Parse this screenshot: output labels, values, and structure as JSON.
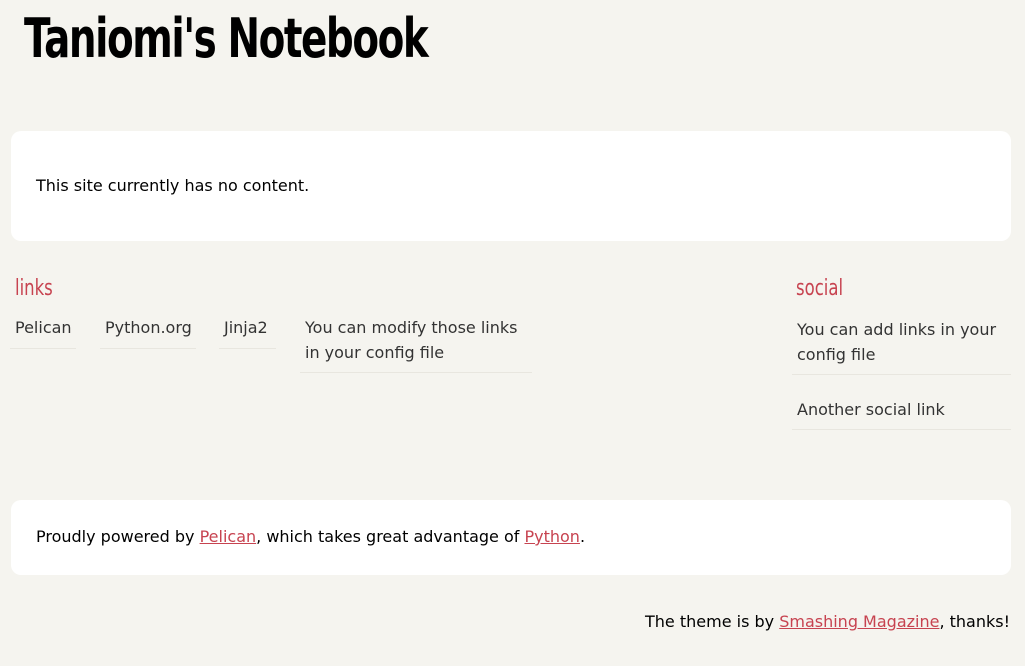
{
  "header": {
    "site_title": "Taniomi's Notebook"
  },
  "content": {
    "message": "This site currently has no content."
  },
  "blogroll": {
    "title": "links",
    "items": [
      {
        "label": "Pelican"
      },
      {
        "label": "Python.org"
      },
      {
        "label": "Jinja2"
      },
      {
        "label": "You can modify those links in your config file"
      }
    ]
  },
  "social": {
    "title": "social",
    "items": [
      {
        "label": "You can add links in your config file"
      },
      {
        "label": "Another social link"
      }
    ]
  },
  "footer": {
    "powered_prefix": "Proudly powered by ",
    "pelican_link": "Pelican",
    "powered_middle": ", which takes great advantage of ",
    "python_link": "Python",
    "powered_suffix": ".",
    "theme_prefix": "The theme is by ",
    "theme_link": "Smashing Magazine",
    "theme_suffix": ", thanks!"
  },
  "colors": {
    "background": "#f5f4ef",
    "accent": "#c74350",
    "panel": "#ffffff"
  }
}
